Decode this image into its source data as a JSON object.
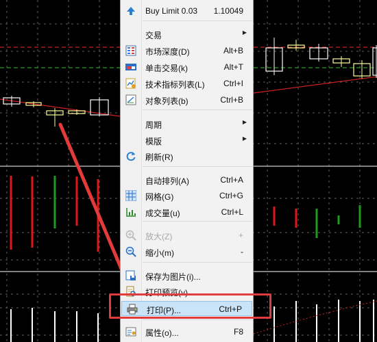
{
  "menu": {
    "items": [
      {
        "id": "buy-limit",
        "label": "Buy Limit 0.03",
        "shortcut": "1.10049",
        "icon": "up-arrow-icon",
        "disabled": false,
        "submenu": false
      },
      {
        "id": "trade",
        "label": "交易",
        "shortcut": "",
        "icon": "",
        "disabled": false,
        "submenu": true
      },
      {
        "id": "market-depth",
        "label": "市场深度(D)",
        "shortcut": "Alt+B",
        "icon": "market-depth-icon",
        "disabled": false,
        "submenu": false
      },
      {
        "id": "one-click-trading",
        "label": "单击交易(k)",
        "shortcut": "Alt+T",
        "icon": "one-click-trading-icon",
        "disabled": false,
        "submenu": false
      },
      {
        "id": "indicators-list",
        "label": "技术指标列表(L)",
        "shortcut": "Ctrl+I",
        "icon": "indicators-list-icon",
        "disabled": false,
        "submenu": false
      },
      {
        "id": "objects-list",
        "label": "对象列表(b)",
        "shortcut": "Ctrl+B",
        "icon": "objects-list-icon",
        "disabled": false,
        "submenu": false
      },
      {
        "id": "period",
        "label": "周期",
        "shortcut": "",
        "icon": "",
        "disabled": false,
        "submenu": true
      },
      {
        "id": "template",
        "label": "模版",
        "shortcut": "",
        "icon": "",
        "disabled": false,
        "submenu": true
      },
      {
        "id": "refresh",
        "label": "刷新(R)",
        "shortcut": "",
        "icon": "refresh-icon",
        "disabled": false,
        "submenu": false
      },
      {
        "id": "auto-arrange",
        "label": "自动排列(A)",
        "shortcut": "Ctrl+A",
        "icon": "",
        "disabled": false,
        "submenu": false
      },
      {
        "id": "grid",
        "label": "网格(G)",
        "shortcut": "Ctrl+G",
        "icon": "grid-icon",
        "disabled": false,
        "submenu": false
      },
      {
        "id": "volumes",
        "label": "成交量(u)",
        "shortcut": "Ctrl+L",
        "icon": "volumes-icon",
        "disabled": false,
        "submenu": false
      },
      {
        "id": "zoom-in",
        "label": "放大(Z)",
        "shortcut": "+",
        "icon": "zoom-in-icon",
        "disabled": true,
        "submenu": false
      },
      {
        "id": "zoom-out",
        "label": "缩小(m)",
        "shortcut": "-",
        "icon": "zoom-out-icon",
        "disabled": false,
        "submenu": false
      },
      {
        "id": "save-as-picture",
        "label": "保存为图片(i)...",
        "shortcut": "",
        "icon": "save-picture-icon",
        "disabled": false,
        "submenu": false
      },
      {
        "id": "print-preview",
        "label": "打印预览(v)",
        "shortcut": "",
        "icon": "print-preview-icon",
        "disabled": false,
        "submenu": false
      },
      {
        "id": "print",
        "label": "打印(P)...",
        "shortcut": "Ctrl+P",
        "icon": "printer-icon",
        "disabled": false,
        "submenu": false,
        "selected": true
      },
      {
        "id": "properties",
        "label": "属性(o)...",
        "shortcut": "F8",
        "icon": "properties-icon",
        "disabled": false,
        "submenu": false
      }
    ]
  },
  "colors": {
    "chart_background": "#000000",
    "bullish_candle": "#ffffff",
    "bearish_candle": "#ffff99",
    "level_line_red": "#ff2a2a",
    "level_line_green": "#2cc42c",
    "bearish_bar": "#e01818",
    "bullish_bar": "#1f9a1f",
    "annotation": "#e23b3b",
    "menu_background": "#f2f2f2",
    "selected_background": "#cbe3f6"
  }
}
